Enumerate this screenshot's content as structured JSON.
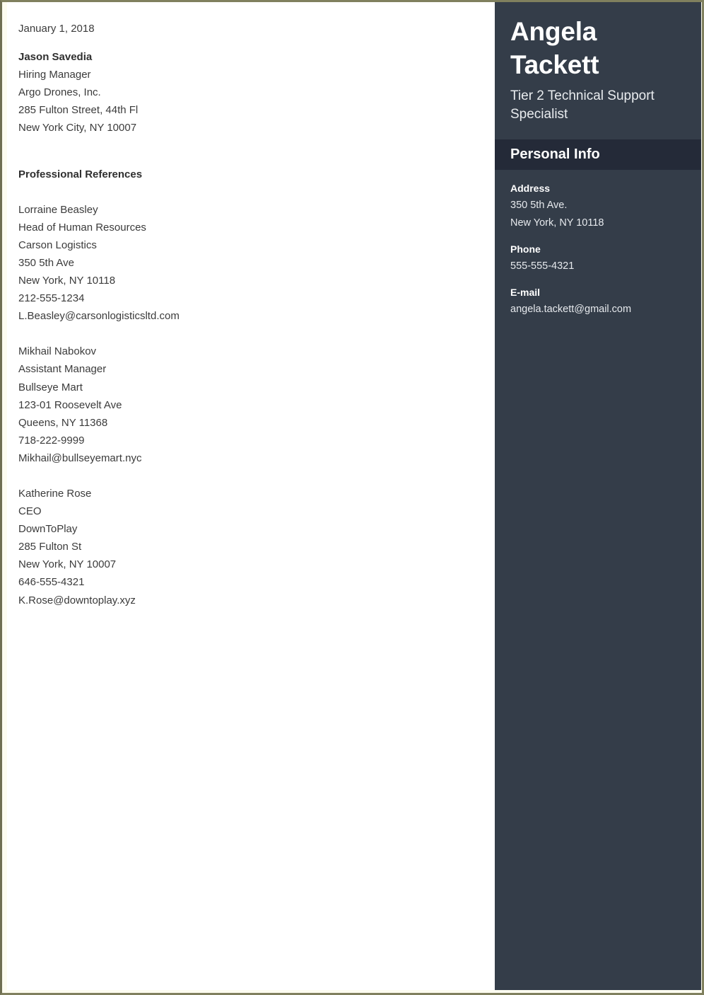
{
  "document": {
    "date": "January 1, 2018",
    "recipient": {
      "name": "Jason Savedia",
      "title": "Hiring Manager",
      "company": "Argo Drones, Inc.",
      "street": "285 Fulton Street, 44th Fl",
      "city_state_zip": "New York City, NY 10007"
    },
    "section_heading": "Professional References",
    "references": [
      {
        "name": "Lorraine Beasley",
        "title": "Head of Human Resources",
        "company": "Carson Logistics",
        "street": "350 5th Ave",
        "city_state_zip": "New York, NY 10118",
        "phone": "212-555-1234",
        "email": "L.Beasley@carsonlogisticsltd.com"
      },
      {
        "name": "Mikhail Nabokov",
        "title": "Assistant Manager",
        "company": "Bullseye Mart",
        "street": "123-01 Roosevelt Ave",
        "city_state_zip": "Queens, NY 11368",
        "phone": "718-222-9999",
        "email": "Mikhail@bullseyemart.nyc"
      },
      {
        "name": "Katherine Rose",
        "title": "CEO",
        "company": "DownToPlay",
        "street": "285 Fulton St",
        "city_state_zip": "New York, NY 10007",
        "phone": "646-555-4321",
        "email": "K.Rose@downtoplay.xyz"
      }
    ]
  },
  "sidebar": {
    "first_name": "Angela",
    "last_name": "Tackett",
    "job_title": "Tier 2 Technical Support Specialist",
    "personal_info_heading": "Personal Info",
    "address_label": "Address",
    "address_line1": "350 5th Ave.",
    "address_line2": "New York, NY 10118",
    "phone_label": "Phone",
    "phone_value": "555-555-4321",
    "email_label": "E-mail",
    "email_value": "angela.tackett@gmail.com"
  },
  "colors": {
    "sidebar_bg": "#343d49",
    "sidebar_bar_bg": "#242a38",
    "page_border": "#80805e",
    "paper_bg": "#ffffff",
    "text": "#3b3b3b"
  }
}
